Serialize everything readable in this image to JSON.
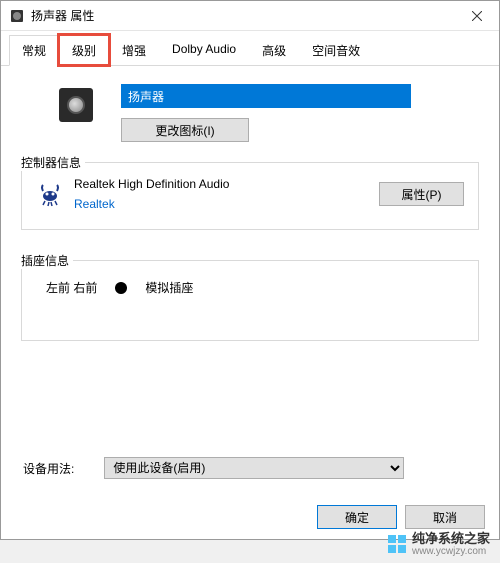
{
  "titlebar": {
    "title": "扬声器 属性"
  },
  "tabs": [
    {
      "label": "常规",
      "active": true,
      "highlight": false
    },
    {
      "label": "级别",
      "active": false,
      "highlight": true
    },
    {
      "label": "增强",
      "active": false,
      "highlight": false
    },
    {
      "label": "Dolby Audio",
      "active": false,
      "highlight": false
    },
    {
      "label": "高级",
      "active": false,
      "highlight": false
    },
    {
      "label": "空间音效",
      "active": false,
      "highlight": false
    }
  ],
  "general": {
    "device_name": "扬声器",
    "change_icon_label": "更改图标(I)"
  },
  "controller": {
    "section_label": "控制器信息",
    "name": "Realtek High Definition Audio",
    "vendor": "Realtek",
    "properties_label": "属性(P)"
  },
  "jack": {
    "section_label": "插座信息",
    "position": "左前 右前",
    "type": "模拟插座"
  },
  "usage": {
    "label": "设备用法:",
    "selected": "使用此设备(启用)"
  },
  "buttons": {
    "ok": "确定",
    "cancel": "取消"
  },
  "watermark": {
    "name": "纯净系统之家",
    "url": "www.ycwjzy.com"
  }
}
